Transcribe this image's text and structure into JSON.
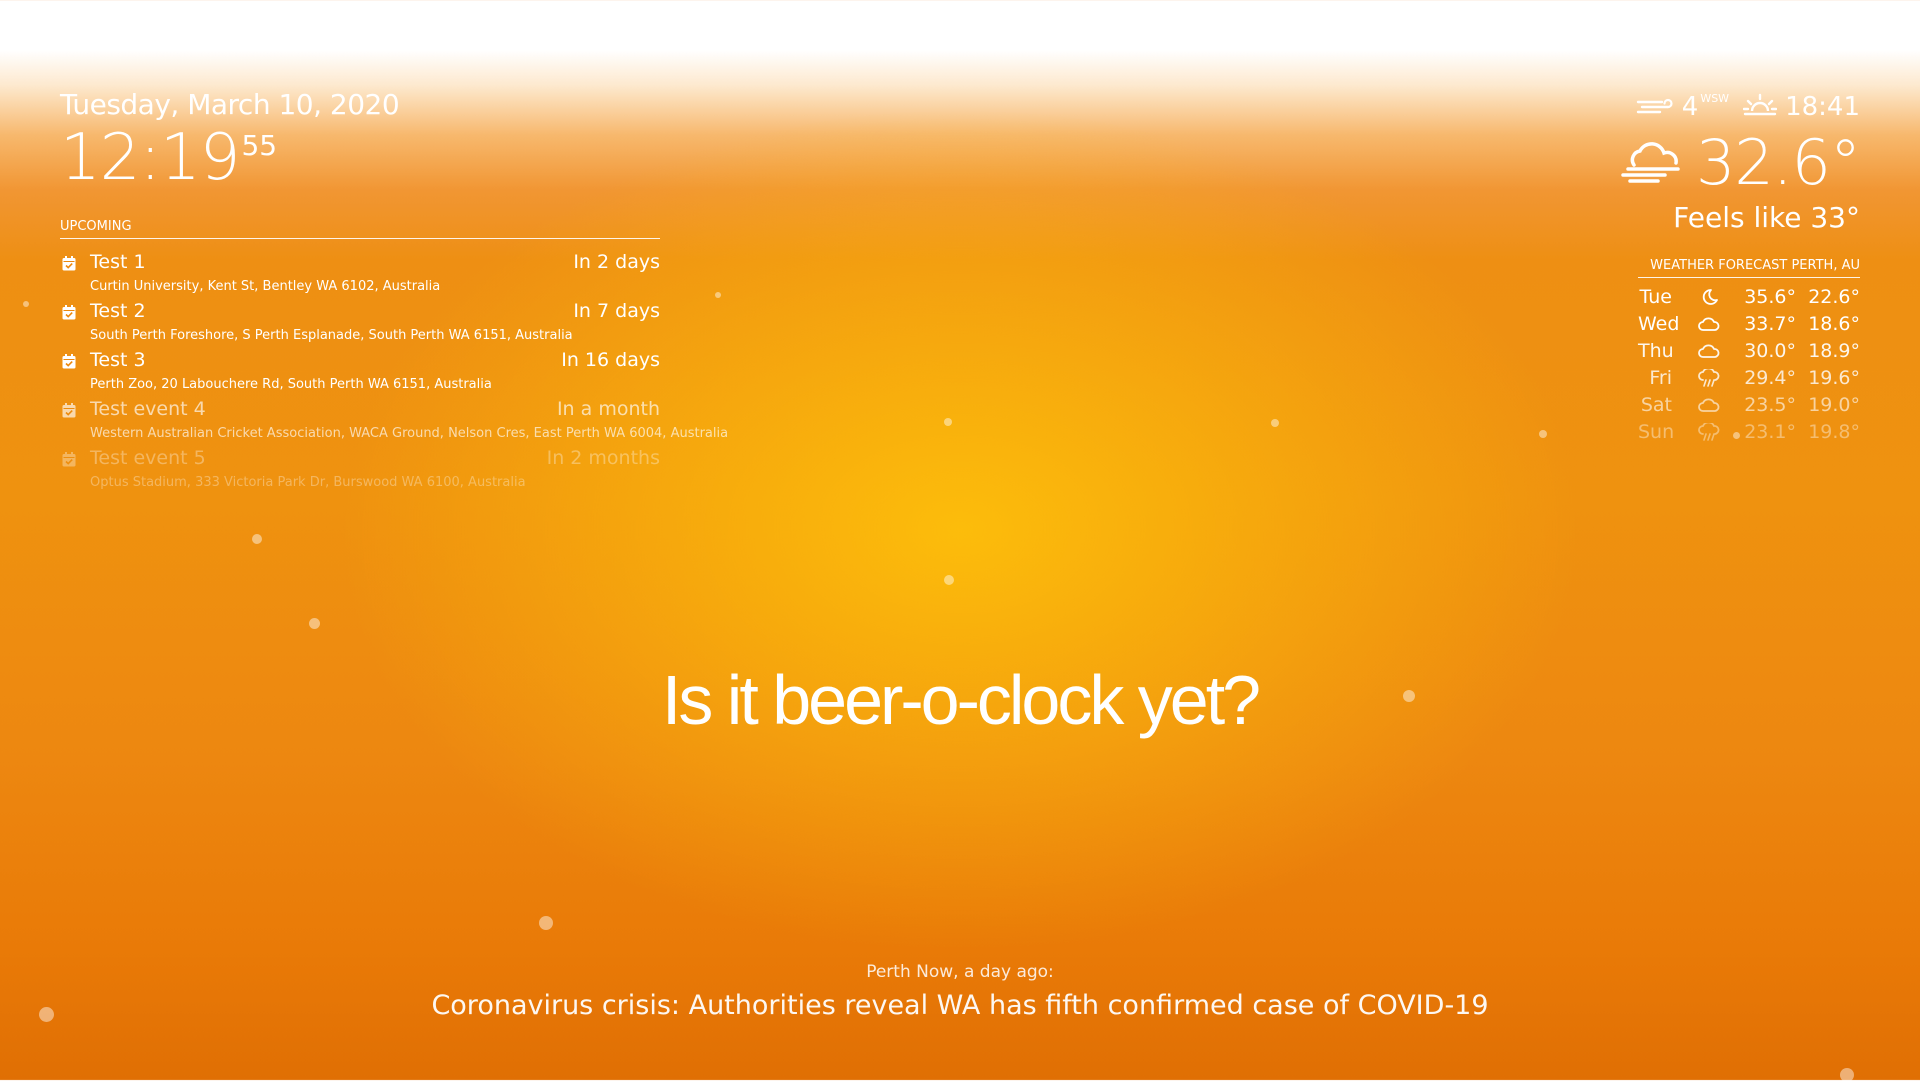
{
  "clock": {
    "date": "Tuesday, March 10, 2020",
    "time": "12:19",
    "seconds": "55"
  },
  "calendar": {
    "header": "UPCOMING",
    "icon": "calendar-check-icon",
    "events": [
      {
        "title": "Test 1",
        "when": "In 2 days",
        "location": "Curtin University, Kent St, Bentley WA 6102, Australia",
        "opacity": 1.0
      },
      {
        "title": "Test 2",
        "when": "In 7 days",
        "location": "South Perth Foreshore, S Perth Esplanade, South Perth WA 6151, Australia",
        "opacity": 1.0
      },
      {
        "title": "Test 3",
        "when": "In 16 days",
        "location": "Perth Zoo, 20 Labouchere Rd, South Perth WA 6151, Australia",
        "opacity": 1.0
      },
      {
        "title": "Test event 4",
        "when": "In a month",
        "location": "Western Australian Cricket Association, WACA Ground, Nelson Cres, East Perth WA 6004, Australia",
        "opacity": 0.66
      },
      {
        "title": "Test event 5",
        "when": "In 2 months",
        "location": "Optus Stadium, 333 Victoria Park Dr, Burswood WA 6100, Australia",
        "opacity": 0.33
      }
    ]
  },
  "current_weather": {
    "wind_speed": "4",
    "wind_direction": "WSW",
    "wind_icon": "wind-icon",
    "sun_icon": "sunset-icon",
    "sun_time": "18:41",
    "condition_icon": "cloudy-windy-icon",
    "temperature": "32.6°",
    "feels_like": "Feels like 33°"
  },
  "forecast": {
    "header": "WEATHER FORECAST PERTH, AU",
    "days": [
      {
        "day": "Tue",
        "icon": "moon-icon",
        "max": "35.6°",
        "min": "22.6°",
        "opacity": 1.0
      },
      {
        "day": "Wed",
        "icon": "cloud-icon",
        "max": "33.7°",
        "min": "18.6°",
        "opacity": 1.0
      },
      {
        "day": "Thu",
        "icon": "cloud-icon",
        "max": "30.0°",
        "min": "18.9°",
        "opacity": 0.92
      },
      {
        "day": "Fri",
        "icon": "rain-cloud-icon",
        "max": "29.4°",
        "min": "19.6°",
        "opacity": 0.8
      },
      {
        "day": "Sat",
        "icon": "cloud-icon",
        "max": "23.5°",
        "min": "19.0°",
        "opacity": 0.6
      },
      {
        "day": "Sun",
        "icon": "rain-cloud-icon",
        "max": "23.1°",
        "min": "19.8°",
        "opacity": 0.4
      }
    ]
  },
  "compliment": "Is it beer-o-clock yet?",
  "news": {
    "source": "Perth Now, a day ago:",
    "headline": "Coronavirus crisis: Authorities reveal WA has fifth confirmed case of COVID-19"
  }
}
